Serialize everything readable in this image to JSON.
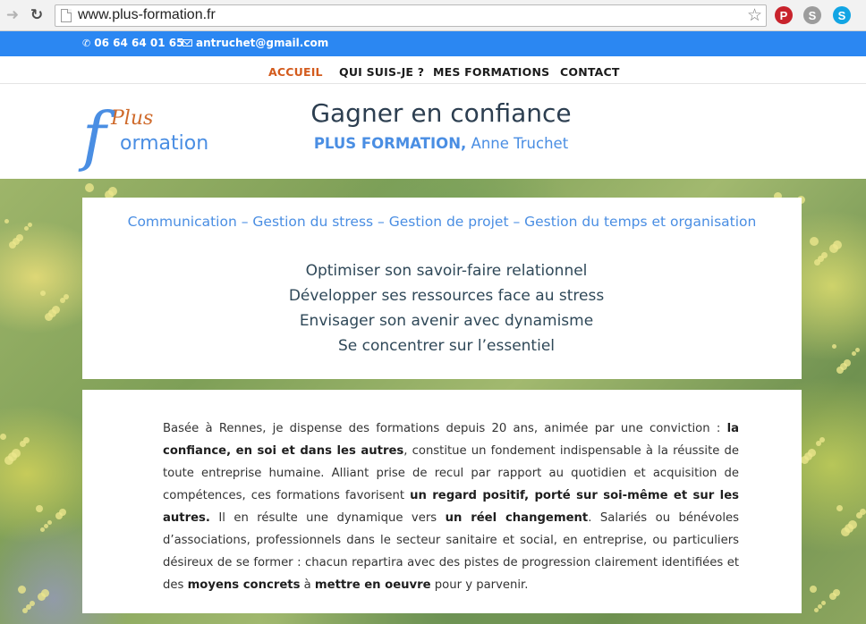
{
  "browser": {
    "url": "www.plus-formation.fr",
    "back_icon": "arrow-right-icon",
    "reload_icon": "reload-icon",
    "bookmark_icon": "star-icon",
    "extensions": [
      {
        "name": "pinterest-icon",
        "glyph": "P",
        "color": "#c8232c"
      },
      {
        "name": "skype-grey-icon",
        "glyph": "S",
        "color": "#9c9c9c"
      },
      {
        "name": "skype-icon",
        "glyph": "S",
        "color": "#12a5e4"
      }
    ]
  },
  "topbar": {
    "phone": "06 64 64 01 65",
    "email": "antruchet@gmail.com",
    "color": "#2b87f2"
  },
  "nav": {
    "items": [
      {
        "label": "ACCUEIL",
        "active": true
      },
      {
        "label": "QUI SUIS-JE ?",
        "active": false
      },
      {
        "label": "MES FORMATIONS",
        "active": false
      },
      {
        "label": "CONTACT",
        "active": false
      }
    ],
    "active_color": "#d35b1d"
  },
  "header": {
    "logo": {
      "letter": "f",
      "plus": "Plus",
      "word": "ormation"
    },
    "title": "Gagner en confiance",
    "subtitle_bold": "PLUS FORMATION,",
    "subtitle_rest": " Anne Truchet"
  },
  "intro": {
    "topics": "Communication – Gestion du stress – Gestion de projet – Gestion du temps et organisation",
    "goals": [
      "Optimiser son savoir-faire relationnel",
      "Développer ses ressources face au stress",
      "Envisager son avenir avec dynamisme",
      "Se concentrer sur l’essentiel"
    ]
  },
  "body": {
    "segments": [
      {
        "text": "Basée à Rennes, je dispense des formations depuis 20 ans, animée par une conviction : ",
        "bold": false
      },
      {
        "text": "la confiance, en soi et dans les autres",
        "bold": true
      },
      {
        "text": ", constitue un fondement indispensable à la réussite de toute entreprise humaine. Alliant prise de recul par rapport au quotidien et acquisition de compétences, ces formations favorisent ",
        "bold": false
      },
      {
        "text": "un regard positif, porté sur soi-même et sur les autres.",
        "bold": true
      },
      {
        "text": " Il en résulte une dynamique vers ",
        "bold": false
      },
      {
        "text": "un réel changement",
        "bold": true
      },
      {
        "text": ". Salariés ou bénévoles d’associations, professionnels dans le secteur sanitaire et social, en entreprise, ou particuliers désireux de se former : chacun repartira avec des pistes de progression clairement identifiées et des ",
        "bold": false
      },
      {
        "text": "moyens concrets",
        "bold": true
      },
      {
        "text": " à ",
        "bold": false
      },
      {
        "text": "mettre en oeuvre",
        "bold": true
      },
      {
        "text": " pour y parvenir.",
        "bold": false
      }
    ]
  }
}
